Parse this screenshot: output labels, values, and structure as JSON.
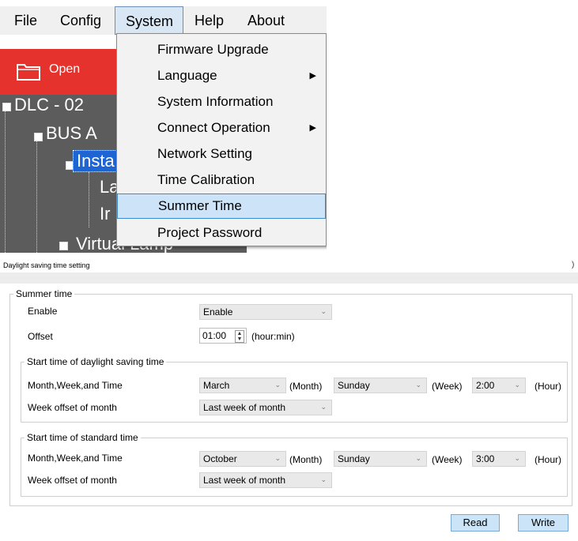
{
  "menubar": {
    "items": [
      "File",
      "Config",
      "System",
      "Help",
      "About"
    ],
    "open_menu": "System"
  },
  "toolbar": {
    "open_label": "Open"
  },
  "tree": {
    "nodes": [
      "DLC - 02",
      "BUS A",
      "Insta",
      "La",
      "Ir",
      "Virtual Lamp"
    ]
  },
  "system_menu": {
    "items": [
      {
        "label": "Firmware Upgrade",
        "submenu": false
      },
      {
        "label": "Language",
        "submenu": true
      },
      {
        "label": "System Information",
        "submenu": false
      },
      {
        "label": "Connect Operation",
        "submenu": true
      },
      {
        "label": "Network Setting",
        "submenu": false
      },
      {
        "label": "Time Calibration",
        "submenu": false
      },
      {
        "label": "Summer Time",
        "submenu": false,
        "highlighted": true
      },
      {
        "label": "Project Password",
        "submenu": false
      }
    ]
  },
  "dialog": {
    "title": "Daylight saving time setting",
    "close_glyph": ")",
    "summer_group": {
      "legend": "Summer time",
      "enable_label": "Enable",
      "enable_value": "Enable",
      "offset_label": "Offset",
      "offset_value": "01:00",
      "offset_unit": "(hour:min)"
    },
    "start_group": {
      "legend": "Start time of daylight saving time",
      "mwt_label": "Month,Week,and Time",
      "month": "March",
      "month_unit": "(Month)",
      "week": "Sunday",
      "week_unit": "(Week)",
      "hour": "2:00",
      "hour_unit": "(Hour)",
      "offset_label": "Week offset of month",
      "offset_value": "Last week of month"
    },
    "standard_group": {
      "legend": "Start time of standard time",
      "mwt_label": "Month,Week,and Time",
      "month": "October",
      "month_unit": "(Month)",
      "week": "Sunday",
      "week_unit": "(Week)",
      "hour": "3:00",
      "hour_unit": "(Hour)",
      "offset_label": "Week offset of month",
      "offset_value": "Last week of month"
    },
    "read_label": "Read",
    "write_label": "Write"
  }
}
